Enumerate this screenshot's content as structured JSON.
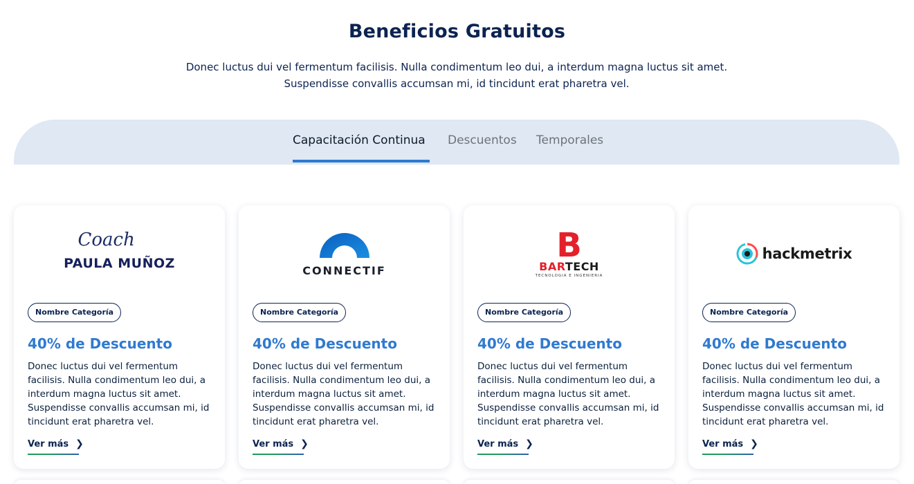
{
  "header": {
    "title": "Beneficios Gratuitos",
    "subtitle_line1": "Donec luctus dui vel fermentum facilisis. Nulla condimentum leo dui, a interdum magna luctus sit amet.",
    "subtitle_line2": "Suspendisse convallis accumsan mi, id tincidunt erat pharetra vel."
  },
  "tabs": [
    {
      "label": "Capacitación Continua",
      "active": true
    },
    {
      "label": "Descuentos",
      "active": false
    },
    {
      "label": "Temporales",
      "active": false
    }
  ],
  "colors": {
    "navy": "#0b2350",
    "accent_blue": "#2f7ad0",
    "tabbar_bg": "#dfe8f3",
    "inactive_tab": "#6f7378"
  },
  "cards": [
    {
      "logo": {
        "line1": "Coach",
        "line2": "PAULA MUÑOZ"
      },
      "category": "Nombre Categoría",
      "discount": "40% de Descuento",
      "description": "Donec luctus dui vel fermentum facilisis. Nulla condimentum leo dui, a interdum magna luctus sit amet. Suspendisse convallis accumsan mi, id tincidunt erat pharetra vel.",
      "more_label": "Ver más"
    },
    {
      "logo": {
        "text": "CONNECTIF"
      },
      "category": "Nombre Categoría",
      "discount": "40% de Descuento",
      "description": "Donec luctus dui vel fermentum facilisis. Nulla condimentum leo dui, a interdum magna luctus sit amet. Suspendisse convallis accumsan mi, id tincidunt erat pharetra vel.",
      "more_label": "Ver más"
    },
    {
      "logo": {
        "mark": "B",
        "word_a": "BAR",
        "word_b": "TECH",
        "tagline": "TECNOLOGIA E INGENIERIA"
      },
      "category": "Nombre Categoría",
      "discount": "40% de Descuento",
      "description": "Donec luctus dui vel fermentum facilisis. Nulla condimentum leo dui, a interdum magna luctus sit amet. Suspendisse convallis accumsan mi, id tincidunt erat pharetra vel.",
      "more_label": "Ver más"
    },
    {
      "logo": {
        "text": "hackmetrix"
      },
      "category": "Nombre Categoría",
      "discount": "40% de Descuento",
      "description": "Donec luctus dui vel fermentum facilisis. Nulla condimentum leo dui, a interdum magna luctus sit amet. Suspendisse convallis accumsan mi, id tincidunt erat pharetra vel.",
      "more_label": "Ver más"
    }
  ]
}
